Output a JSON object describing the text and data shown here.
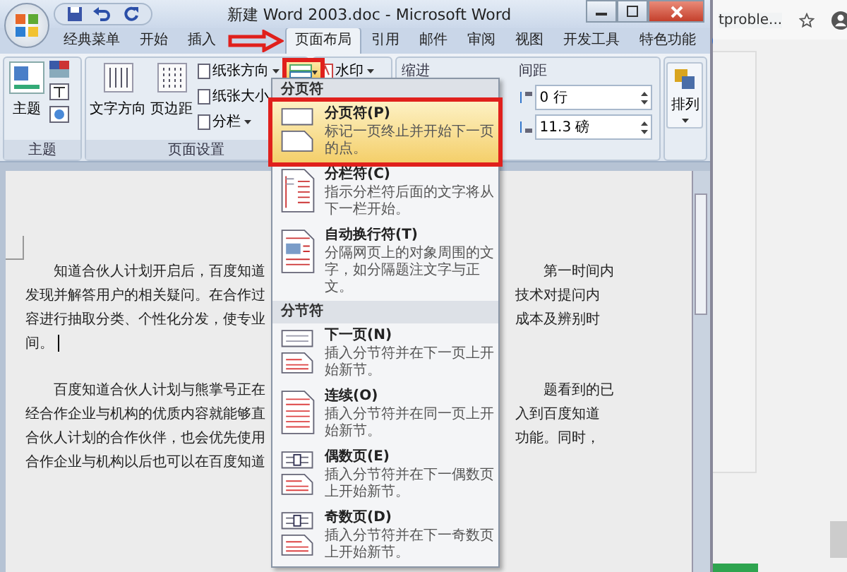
{
  "window": {
    "title": "新建 Word 2003.doc - Microsoft Word"
  },
  "tabs": [
    {
      "label": "经典菜单",
      "selected": false
    },
    {
      "label": "开始",
      "selected": false
    },
    {
      "label": "插入",
      "selected": false
    },
    {
      "label": "页面布局",
      "selected": true
    },
    {
      "label": "引用",
      "selected": false
    },
    {
      "label": "邮件",
      "selected": false
    },
    {
      "label": "审阅",
      "selected": false
    },
    {
      "label": "视图",
      "selected": false
    },
    {
      "label": "开发工具",
      "selected": false
    },
    {
      "label": "特色功能",
      "selected": false
    }
  ],
  "ribbon": {
    "theme_group": {
      "button": "主题",
      "label": "主题"
    },
    "page_setup_group": {
      "large_buttons": [
        "文字方向",
        "页边距"
      ],
      "small_buttons": [
        "纸张方向",
        "纸张大小",
        "分栏"
      ],
      "label": "页面设置"
    },
    "background_group": {
      "watermark": "水印"
    },
    "paragraph_group": {
      "indent_label": "缩进",
      "spacing_label": "间距",
      "spacing_before": "0 行",
      "spacing_after": "11.3 磅"
    },
    "arrange_group": {
      "button": "排列"
    }
  },
  "breaks_menu": {
    "sections": [
      {
        "header": "分页符",
        "items": [
          {
            "kind": "page",
            "title": "分页符(P)",
            "description": "标记一页终止并开始下一页的点。",
            "selected": true
          },
          {
            "kind": "column",
            "title": "分栏符(C)",
            "description": "指示分栏符后面的文字将从下一栏开始。",
            "selected": false
          },
          {
            "kind": "wrap",
            "title": "自动换行符(T)",
            "description": "分隔网页上的对象周围的文字，如分隔题注文字与正文。",
            "selected": false
          }
        ]
      },
      {
        "header": "分节符",
        "items": [
          {
            "kind": "next",
            "title": "下一页(N)",
            "description": "插入分节符并在下一页上开始新节。",
            "selected": false
          },
          {
            "kind": "continuous",
            "title": "连续(O)",
            "description": "插入分节符并在同一页上开始新节。",
            "selected": false
          },
          {
            "kind": "even",
            "title": "偶数页(E)",
            "description": "插入分节符并在下一偶数页上开始新节。",
            "selected": false
          },
          {
            "kind": "odd",
            "title": "奇数页(D)",
            "description": "插入分节符并在下一奇数页上开始新节。",
            "selected": false
          }
        ]
      }
    ]
  },
  "document": {
    "paragraphs": [
      {
        "lines": [
          {
            "left": "知道合伙人计划开启后，百度知道",
            "right": "第一时间内"
          },
          {
            "left": "发现并解答用户的相关疑问。在合作过",
            "right": "技术对提问内"
          },
          {
            "left": "容进行抽取分类、个性化分发，使专业",
            "right": "成本及辨别时"
          },
          {
            "left": "间。"
          }
        ]
      },
      {
        "lines": [
          {
            "left": "百度知道合伙人计划与熊掌号正在",
            "right": "题看到的已"
          },
          {
            "left": "经合作企业与机构的优质内容就能够直",
            "right": "入到百度知道"
          },
          {
            "left": "合伙人计划的合作伙伴，也会优先使用",
            "right": "功能。同时，"
          },
          {
            "left": "合作企业与机构以后也可以在百度知道"
          }
        ]
      }
    ]
  },
  "browser": {
    "tab_title": "tproble..."
  }
}
